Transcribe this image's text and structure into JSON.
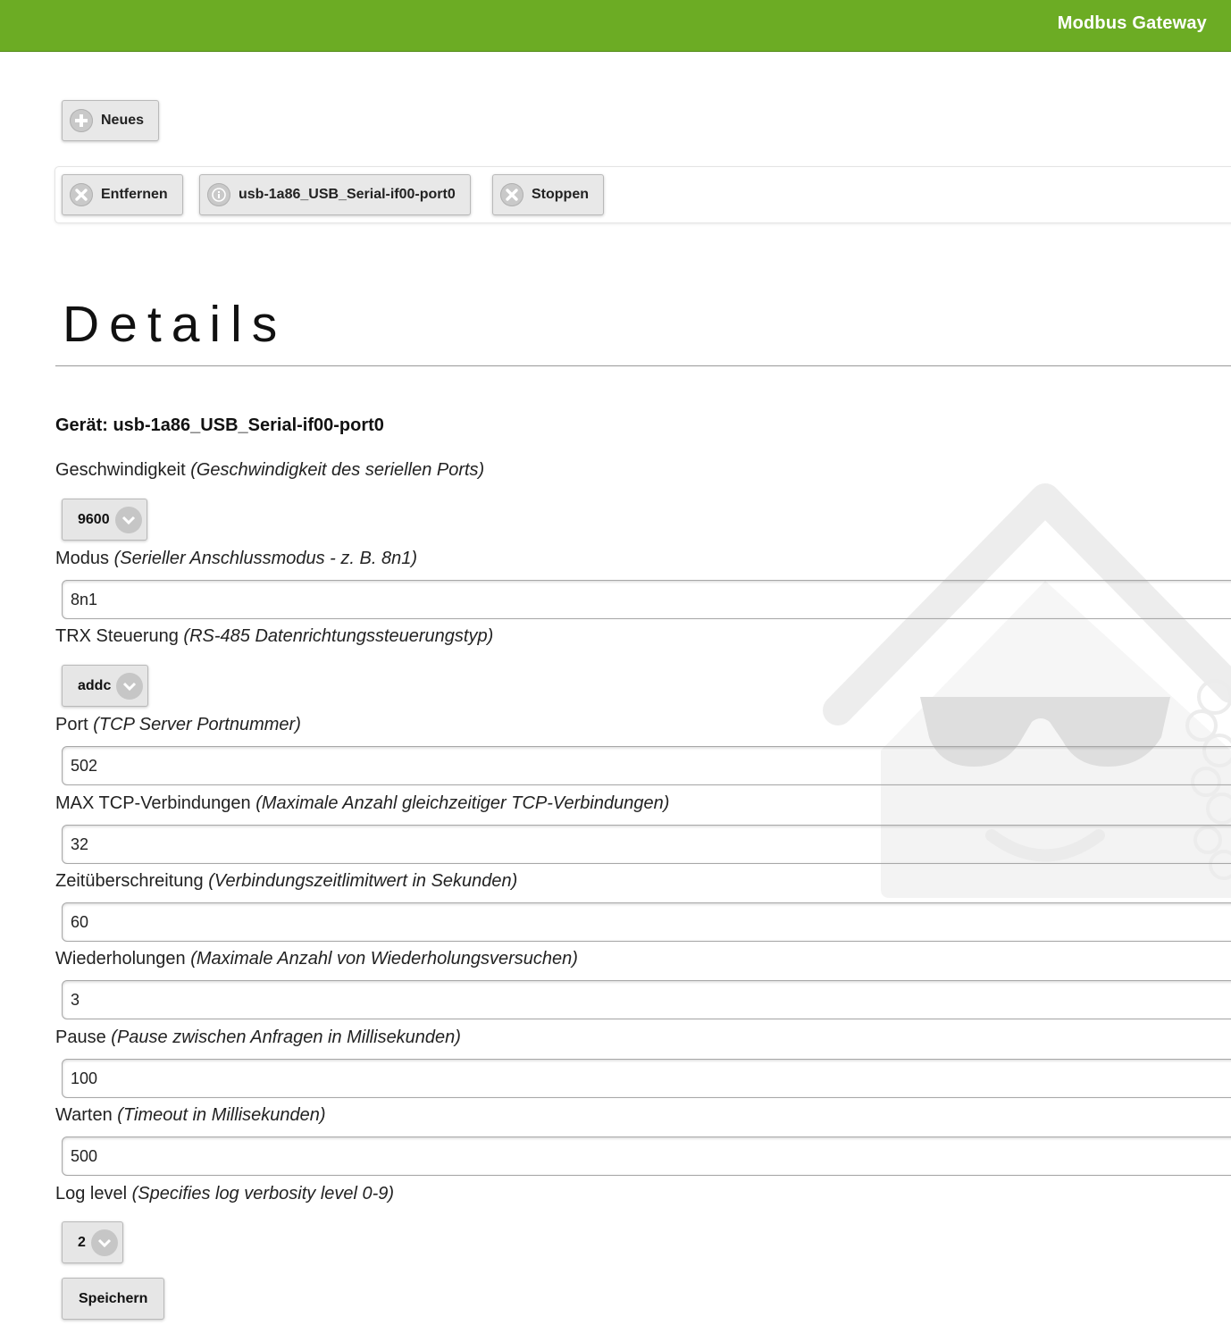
{
  "header": {
    "title": "Modbus Gateway"
  },
  "toolbar": {
    "new_label": "Neues",
    "remove_label": "Entfernen",
    "device_label": "usb-1a86_USB_Serial-if00-port0",
    "stop_label": "Stoppen"
  },
  "details": {
    "heading": "Details",
    "device_prefix": "Gerät: ",
    "device_name": "usb-1a86_USB_Serial-if00-port0",
    "fields": {
      "speed": {
        "label": "Geschwindigkeit",
        "hint": "(Geschwindigkeit des seriellen Ports)",
        "value": "9600"
      },
      "mode": {
        "label": "Modus",
        "hint": "(Serieller Anschlussmodus - z. B. 8n1)",
        "value": "8n1"
      },
      "trx": {
        "label": "TRX Steuerung",
        "hint": "(RS-485 Datenrichtungssteuerungstyp)",
        "value": "addc"
      },
      "port": {
        "label": "Port",
        "hint": "(TCP Server Portnummer)",
        "value": "502"
      },
      "max_tcp": {
        "label": "MAX TCP-Verbindungen",
        "hint": "(Maximale Anzahl gleichzeitiger TCP-Verbindungen)",
        "value": "32"
      },
      "timeout": {
        "label": "Zeitüberschreitung",
        "hint": "(Verbindungszeitlimitwert in Sekunden)",
        "value": "60"
      },
      "retries": {
        "label": "Wiederholungen",
        "hint": "(Maximale Anzahl von Wiederholungsversuchen)",
        "value": "3"
      },
      "pause": {
        "label": "Pause",
        "hint": "(Pause zwischen Anfragen in Millisekunden)",
        "value": "100"
      },
      "wait": {
        "label": "Warten",
        "hint": "(Timeout in Millisekunden)",
        "value": "500"
      },
      "log_level": {
        "label": "Log level",
        "hint": "(Specifies log verbosity level 0-9)",
        "value": "2"
      }
    },
    "save_label": "Speichern"
  },
  "colors": {
    "header_green": "#6cac24",
    "button_gray": "#e8e8e8"
  },
  "icons": {
    "new": "plus-circle-icon",
    "remove": "x-circle-icon",
    "device": "info-circle-icon",
    "stop": "x-circle-icon",
    "dropdown": "chevron-down-icon",
    "watermark": "house-sunglasses-logo-icon"
  }
}
